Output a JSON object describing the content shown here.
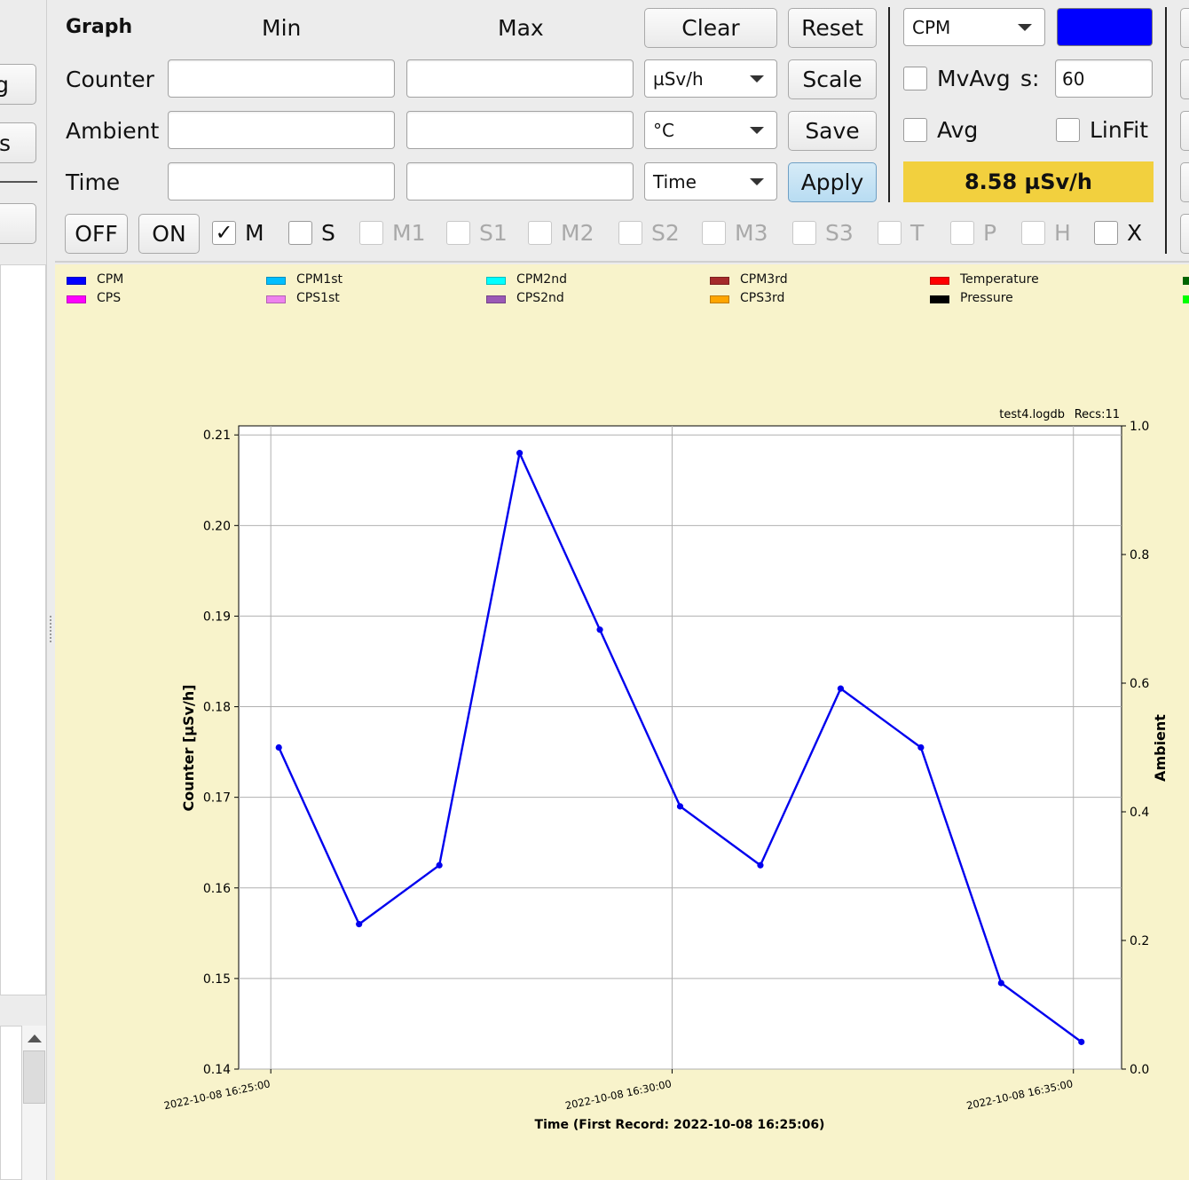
{
  "controls": {
    "graph_label": "Graph",
    "min_label": "Min",
    "max_label": "Max",
    "rows": {
      "counter": "Counter",
      "ambient": "Ambient",
      "time": "Time"
    },
    "unit_select": "µSv/h",
    "temp_select": "°C",
    "time_select": "Time",
    "buttons": {
      "clear": "Clear",
      "reset": "Reset",
      "scale": "Scale",
      "save": "Save",
      "apply": "Apply",
      "off": "OFF",
      "on": "ON"
    },
    "variable_select": "CPM",
    "variable_color": "#0000ff",
    "mvavg_label": "MvAvg",
    "s_label": "s:",
    "mvavg_value": "60",
    "avg_label": "Avg",
    "linfit_label": "LinFit",
    "dose_display": "8.58 µSv/h",
    "dose_bg": "#f2d03e",
    "checkboxes": [
      {
        "label": "M",
        "checked": true,
        "enabled": true
      },
      {
        "label": "S",
        "checked": false,
        "enabled": true
      },
      {
        "label": "M1",
        "checked": false,
        "enabled": false
      },
      {
        "label": "S1",
        "checked": false,
        "enabled": false
      },
      {
        "label": "M2",
        "checked": false,
        "enabled": false
      },
      {
        "label": "S2",
        "checked": false,
        "enabled": false
      },
      {
        "label": "M3",
        "checked": false,
        "enabled": false
      },
      {
        "label": "S3",
        "checked": false,
        "enabled": false
      },
      {
        "label": "T",
        "checked": false,
        "enabled": false
      },
      {
        "label": "P",
        "checked": false,
        "enabled": false
      },
      {
        "label": "H",
        "checked": false,
        "enabled": false
      },
      {
        "label": "X",
        "checked": false,
        "enabled": true
      }
    ],
    "left_partial_buttons": [
      "g",
      "s"
    ]
  },
  "legend": [
    {
      "name": "CPM",
      "color": "#0000ff"
    },
    {
      "name": "CPS",
      "color": "#ff00ff"
    },
    {
      "name": "CPM1st",
      "color": "#00bfff"
    },
    {
      "name": "CPS1st",
      "color": "#ee82ee"
    },
    {
      "name": "CPM2nd",
      "color": "#00ffff"
    },
    {
      "name": "CPS2nd",
      "color": "#9b59b6"
    },
    {
      "name": "CPM3rd",
      "color": "#a52a2a"
    },
    {
      "name": "CPS3rd",
      "color": "#ffa500"
    },
    {
      "name": "Temperature",
      "color": "#ff0000"
    },
    {
      "name": "Pressure",
      "color": "#000000"
    }
  ],
  "chart_data": {
    "type": "line",
    "file_label": "test4.logdb",
    "recs_label": "Recs:11",
    "xlabel": "Time (First Record: 2022-10-08 16:25:06)",
    "ylabel": "Counter  [µSv/h]",
    "ylabel_right": "Ambient",
    "x_ticks": [
      "2022-10-08  16:25:00",
      "2022-10-08  16:30:00",
      "2022-10-08  16:35:00"
    ],
    "x_tick_minutes": [
      0,
      5,
      10
    ],
    "xlim_minutes": [
      -0.4,
      10.6
    ],
    "ylim": [
      0.14,
      0.211
    ],
    "y_ticks": [
      0.14,
      0.15,
      0.16,
      0.17,
      0.18,
      0.19,
      0.2,
      0.21
    ],
    "y_right_ticks": [
      0.0,
      0.2,
      0.4,
      0.6,
      0.8,
      1.0
    ],
    "grid": true,
    "series": [
      {
        "name": "CPM",
        "color": "#0000ee",
        "x_minutes": [
          0.1,
          1.1,
          2.1,
          3.1,
          4.1,
          5.1,
          6.1,
          7.1,
          8.1,
          9.1,
          10.1
        ],
        "values": [
          0.1755,
          0.156,
          0.1625,
          0.208,
          0.1885,
          0.169,
          0.1625,
          0.182,
          0.1755,
          0.1495,
          0.143
        ]
      }
    ]
  }
}
